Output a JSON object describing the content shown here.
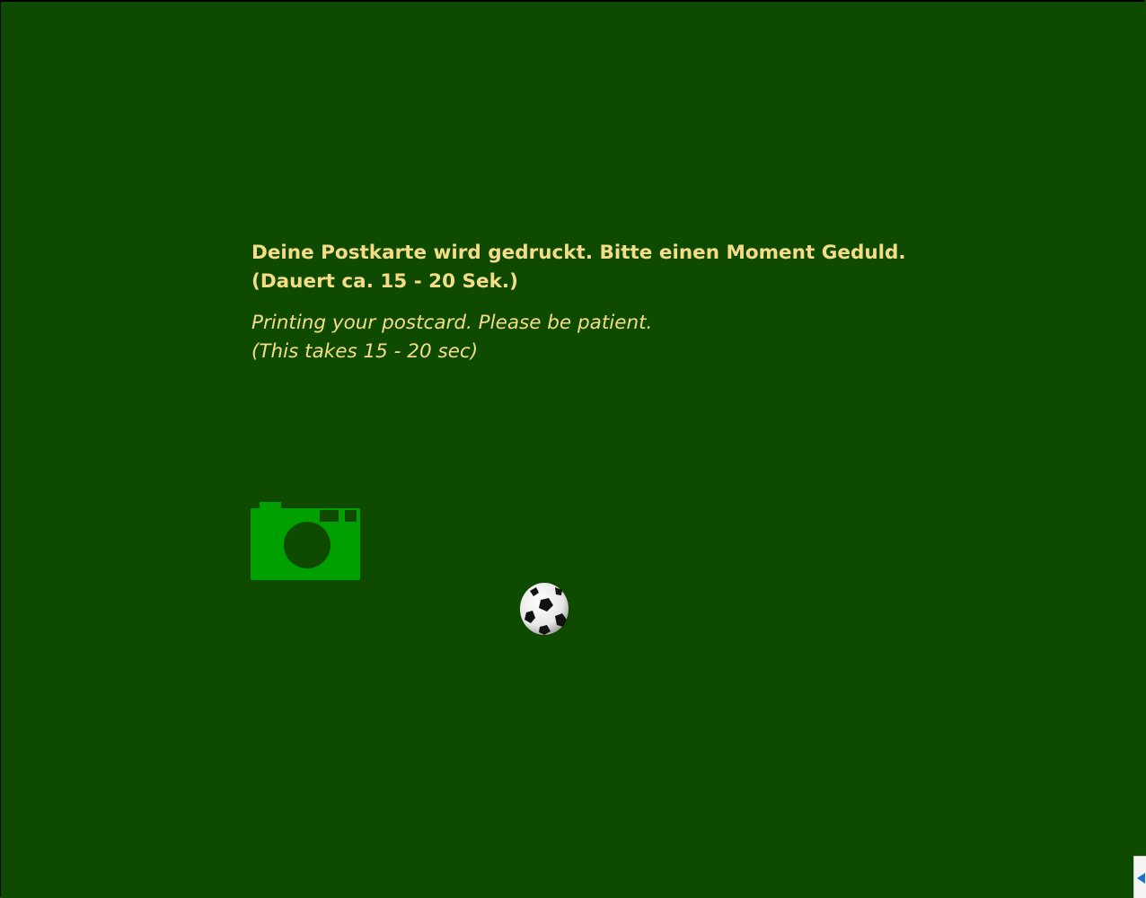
{
  "colors": {
    "background": "#0e4b00",
    "text": "#f5dc87",
    "camera": "#00a000",
    "camera_detail": "#0e4b00"
  },
  "message": {
    "de_line1": "Deine Postkarte wird gedruckt. Bitte einen Moment Geduld.",
    "de_line2": "(Dauert ca. 15 - 20 Sek.)",
    "en_line1": "Printing your postcard. Please be patient.",
    "en_line2": "(This takes 15 - 20 sec)"
  },
  "icons": {
    "camera": "camera-icon",
    "ball": "soccer-ball-icon",
    "arrow": "arrow-left-icon"
  }
}
